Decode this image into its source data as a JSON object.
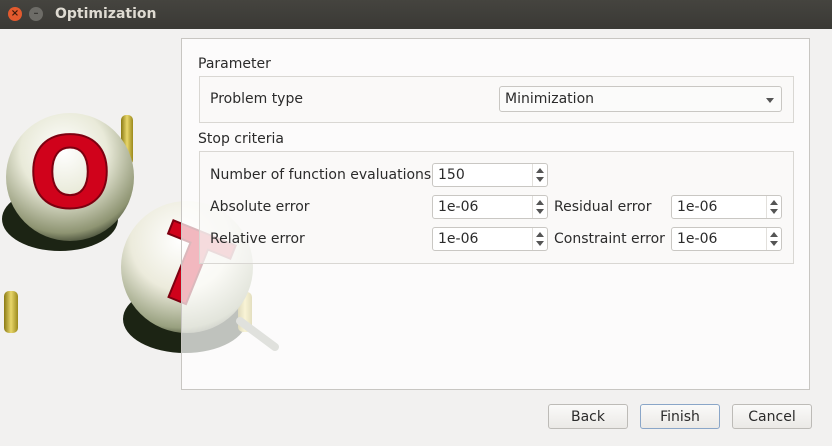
{
  "window": {
    "title": "Optimization",
    "close_glyph": "×",
    "minimize_glyph": "–"
  },
  "parameter": {
    "section_label": "Parameter",
    "problem_type_label": "Problem type",
    "problem_type_value": "Minimization"
  },
  "stop_criteria": {
    "section_label": "Stop criteria",
    "fields": {
      "function_evaluations": {
        "label": "Number of function evaluations",
        "value": "150"
      },
      "absolute_error": {
        "label": "Absolute error",
        "value": "1e-06"
      },
      "relative_error": {
        "label": "Relative error",
        "value": "1e-06"
      },
      "residual_error": {
        "label": "Residual error",
        "value": "1e-06"
      },
      "constraint_error": {
        "label": "Constraint error",
        "value": "1e-06"
      }
    }
  },
  "buttons": {
    "back": "Back",
    "finish": "Finish",
    "cancel": "Cancel"
  },
  "logo": {
    "letter_1": "O",
    "letter_2": "T",
    "letter_color": "#d0021b"
  }
}
